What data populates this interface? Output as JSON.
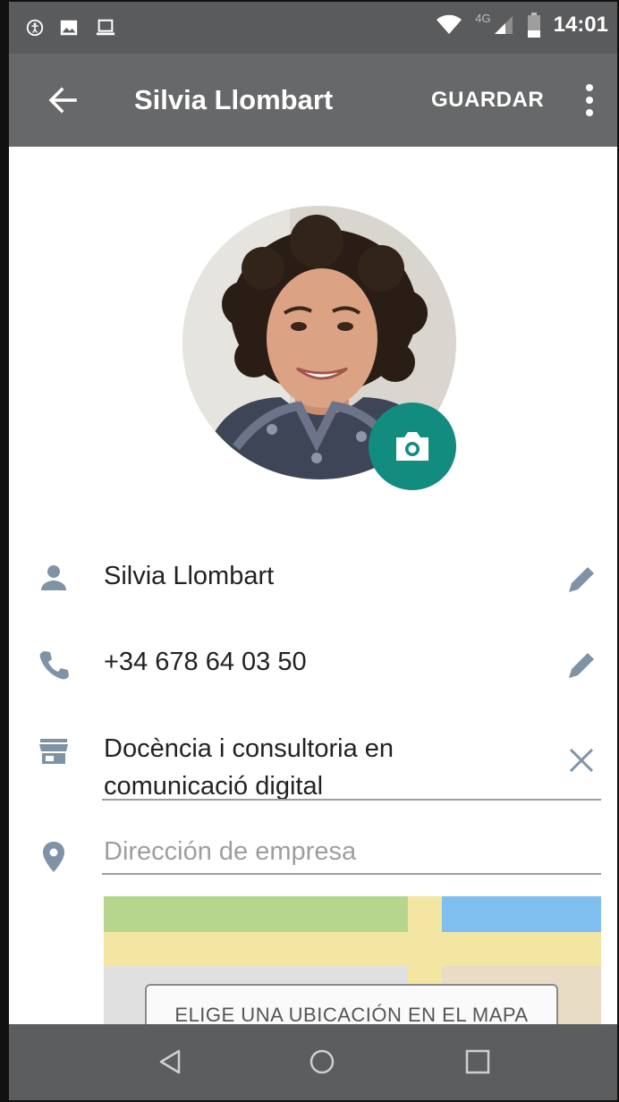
{
  "status_bar": {
    "time": "14:01",
    "network": "4G",
    "icons": [
      "accessibility-icon",
      "image-icon",
      "laptop-icon",
      "wifi-icon",
      "signal-icon",
      "battery-icon"
    ]
  },
  "app_bar": {
    "title": "Silvia Llombart",
    "save_label": "GUARDAR",
    "icons": [
      "back-arrow-icon",
      "more-vert-icon"
    ]
  },
  "profile": {
    "photo_icon": "camera-icon",
    "accent_color": "#128c7e"
  },
  "fields": {
    "name": {
      "value": "Silvia Llombart",
      "icon": "person-icon",
      "action_icon": "pencil-icon"
    },
    "phone": {
      "value": "+34 678 64 03 50",
      "icon": "phone-icon",
      "action_icon": "pencil-icon"
    },
    "business": {
      "line1": "Docència i consultoria en",
      "line2": "comunicació digital",
      "icon": "store-icon",
      "action_icon": "close-icon"
    },
    "address": {
      "value": "",
      "placeholder": "Dirección de empresa",
      "icon": "location-pin-icon"
    }
  },
  "map": {
    "button_label": "ELIGE UNA UBICACIÓN EN EL MAPA"
  },
  "nav_bar": {
    "icons": [
      "back-triangle-icon",
      "home-circle-icon",
      "recents-square-icon"
    ]
  }
}
